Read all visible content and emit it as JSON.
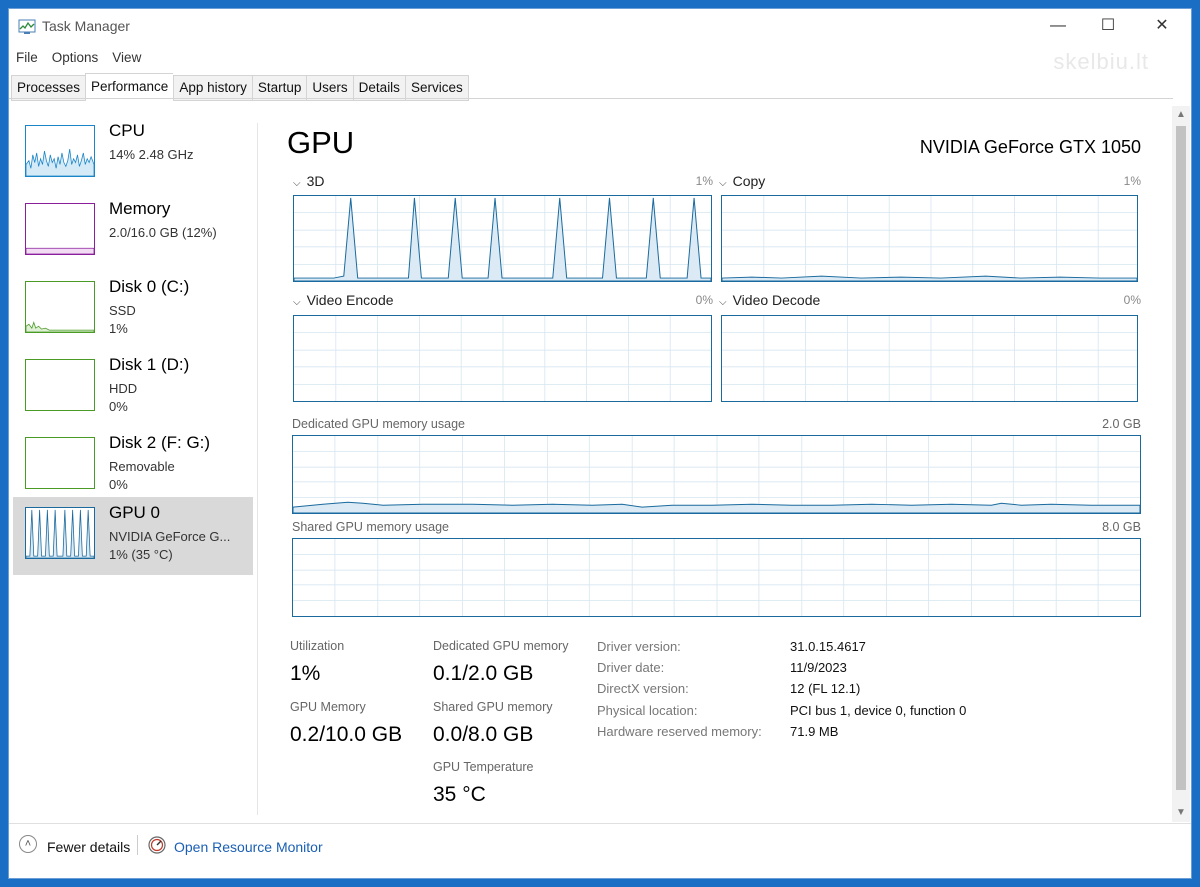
{
  "window": {
    "title": "Task Manager",
    "minimize_glyph": "—",
    "maximize_glyph": "☐",
    "close_glyph": "✕",
    "watermark": "skelbiu.lt"
  },
  "menu": {
    "file": "File",
    "options": "Options",
    "view": "View"
  },
  "tabs": [
    "Processes",
    "Performance",
    "App history",
    "Startup",
    "Users",
    "Details",
    "Services"
  ],
  "sidebar": [
    {
      "name": "CPU",
      "line1": "14% 2.48 GHz",
      "line2": ""
    },
    {
      "name": "Memory",
      "line1": "2.0/16.0 GB (12%)",
      "line2": ""
    },
    {
      "name": "Disk 0 (C:)",
      "line1": "SSD",
      "line2": "1%"
    },
    {
      "name": "Disk 1 (D:)",
      "line1": "HDD",
      "line2": "0%"
    },
    {
      "name": "Disk 2 (F: G:)",
      "line1": "Removable",
      "line2": "0%"
    },
    {
      "name": "GPU 0",
      "line1": "NVIDIA GeForce G...",
      "line2": "1% (35 °C)"
    }
  ],
  "colors": {
    "cpu": "#1a85c8",
    "memory": "#8b1e9b",
    "disk": "#4a9a26",
    "gpu": "#1a6a9e",
    "accent_link": "#1a5fb4"
  },
  "main": {
    "title": "GPU",
    "model": "NVIDIA GeForce GTX 1050",
    "graphs": {
      "3d": {
        "label": "3D",
        "value": "1%"
      },
      "copy": {
        "label": "Copy",
        "value": "1%"
      },
      "encode": {
        "label": "Video Encode",
        "value": "0%"
      },
      "decode": {
        "label": "Video Decode",
        "value": "0%"
      },
      "dedicated": {
        "label": "Dedicated GPU memory usage",
        "value": "2.0 GB"
      },
      "shared": {
        "label": "Shared GPU memory usage",
        "value": "8.0 GB"
      }
    },
    "stats": {
      "utilization_label": "Utilization",
      "utilization_value": "1%",
      "gpu_memory_label": "GPU Memory",
      "gpu_memory_value": "0.2/10.0 GB",
      "dedicated_label": "Dedicated GPU memory",
      "dedicated_value": "0.1/2.0 GB",
      "shared_label": "Shared GPU memory",
      "shared_value": "0.0/8.0 GB",
      "temp_label": "GPU Temperature",
      "temp_value": "35 °C"
    },
    "info": [
      {
        "key": "Driver version:",
        "value": "31.0.15.4617"
      },
      {
        "key": "Driver date:",
        "value": "11/9/2023"
      },
      {
        "key": "DirectX version:",
        "value": "12 (FL 12.1)"
      },
      {
        "key": "Physical location:",
        "value": "PCI bus 1, device 0, function 0"
      },
      {
        "key": "Hardware reserved memory:",
        "value": "71.9 MB"
      }
    ]
  },
  "footer": {
    "fewer_details": "Fewer details",
    "open_resource_monitor": "Open Resource Monitor"
  }
}
